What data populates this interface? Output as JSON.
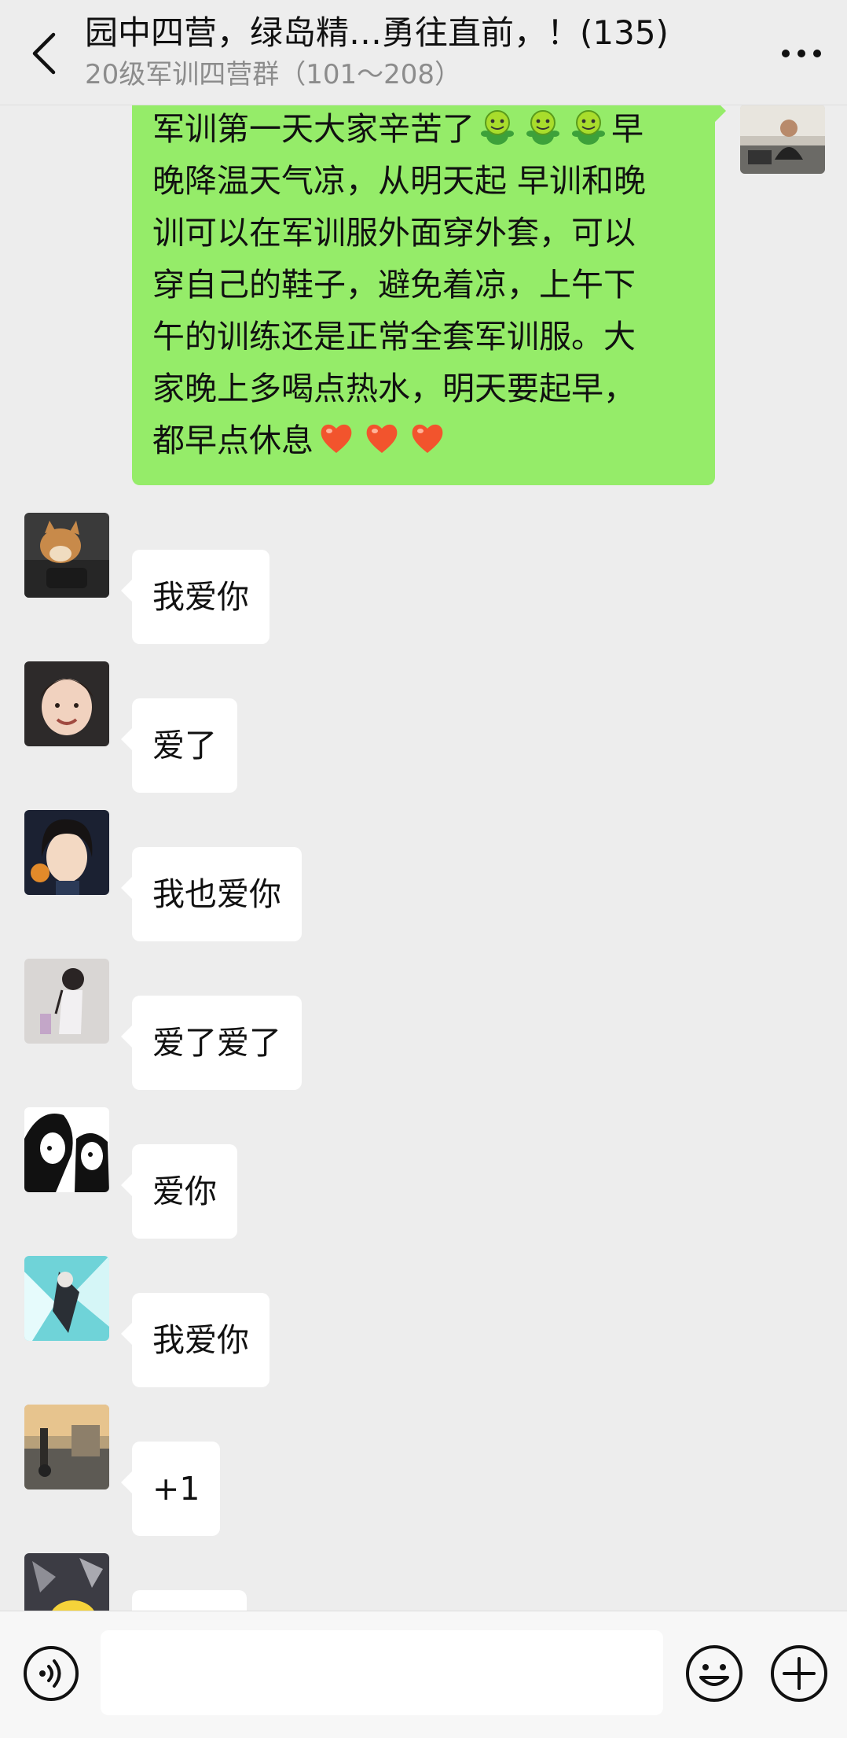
{
  "header": {
    "title": "园中四营，绿岛精…勇往直前，！(135)",
    "subtitle": "20级军训四营群（101～208）"
  },
  "chat": {
    "my_message": {
      "lines": [
        "军训第一天大家辛苦了",
        "晚降温天气凉，从明天起 早训和晚",
        "训可以在军训服外面穿外套，可以",
        "穿自己的鞋子，避免着凉，上午下",
        "午的训练还是正常全套军训服。大",
        "家晚上多喝点热水，明天要起早，",
        "都早点休息"
      ],
      "line1_tail": "早"
    },
    "messages": [
      {
        "text": "我爱你"
      },
      {
        "text": "爱了"
      },
      {
        "text": "我也爱你"
      },
      {
        "text": "爱了爱了"
      },
      {
        "text": "爱你"
      },
      {
        "text": "我爱你"
      },
      {
        "text": "+1"
      },
      {
        "text": ""
      }
    ]
  },
  "input_bar": {
    "placeholder": ""
  },
  "colors": {
    "background": "#ededed",
    "my_bubble": "#95ec69",
    "other_bubble": "#ffffff",
    "subtitle": "#8c8c8c"
  },
  "icons": [
    "back-arrow-icon",
    "more-dots-icon",
    "voice-icon",
    "smiley-icon",
    "plus-icon",
    "frog-emoji-icon",
    "heart-emoji-icon"
  ]
}
